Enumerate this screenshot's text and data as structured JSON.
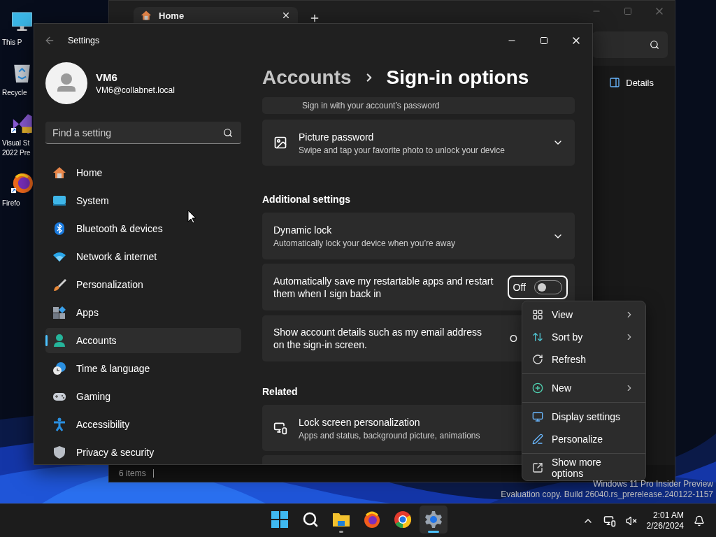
{
  "desktop_icons": [
    {
      "kind": "monitor",
      "lines": [
        "This P"
      ]
    },
    {
      "kind": "recycle",
      "lines": [
        "Recycle"
      ]
    },
    {
      "kind": "vs",
      "lines": [
        "Visual St",
        "2022 Pre"
      ]
    },
    {
      "kind": "firefox",
      "lines": [
        "Firefo"
      ]
    }
  ],
  "explorer": {
    "tab": {
      "label": "Home"
    },
    "details_button": "Details",
    "status": "6 items"
  },
  "settings": {
    "title": "Settings",
    "user": {
      "name": "VM6",
      "email": "VM6@collabnet.local"
    },
    "search": {
      "placeholder": "Find a setting"
    },
    "nav": [
      {
        "label": "Home",
        "selected": false
      },
      {
        "label": "System",
        "selected": false
      },
      {
        "label": "Bluetooth & devices",
        "selected": false
      },
      {
        "label": "Network & internet",
        "selected": false
      },
      {
        "label": "Personalization",
        "selected": false
      },
      {
        "label": "Apps",
        "selected": false
      },
      {
        "label": "Accounts",
        "selected": true
      },
      {
        "label": "Time & language",
        "selected": false
      },
      {
        "label": "Gaming",
        "selected": false
      },
      {
        "label": "Accessibility",
        "selected": false
      },
      {
        "label": "Privacy & security",
        "selected": false
      }
    ],
    "breadcrumb": {
      "parent": "Accounts",
      "current": "Sign-in options"
    },
    "content": [
      {
        "kind": "cut",
        "subtitle": "Sign in with your account’s password"
      },
      {
        "kind": "picture-expander",
        "title": "Picture password",
        "subtitle": "Swipe and tap your favorite photo to unlock your device"
      },
      {
        "kind": "heading",
        "title": "Additional settings"
      },
      {
        "kind": "expander",
        "title": "Dynamic lock",
        "subtitle": "Automatically lock your device when you’re away"
      },
      {
        "kind": "toggle",
        "title": "Automatically save my restartable apps and restart them when I sign back in",
        "state": "Off",
        "on": false,
        "focused": true
      },
      {
        "kind": "covered-toggle",
        "title": "Show account details such as my email address on the sign-in screen.",
        "state": "O"
      },
      {
        "kind": "heading",
        "title": "Related"
      },
      {
        "kind": "lockscreen-link",
        "title": "Lock screen personalization",
        "subtitle": "Apps and status, background picture, animations"
      },
      {
        "kind": "blank"
      }
    ]
  },
  "context_menu": {
    "groups": [
      [
        {
          "label": "View",
          "submenu": true
        },
        {
          "label": "Sort by",
          "submenu": true
        },
        {
          "label": "Refresh",
          "submenu": false
        }
      ],
      [
        {
          "label": "New",
          "submenu": true
        }
      ],
      [
        {
          "label": "Display settings",
          "submenu": false
        },
        {
          "label": "Personalize",
          "submenu": false
        }
      ],
      [
        {
          "label": "Show more options",
          "submenu": false
        }
      ]
    ]
  },
  "watermark": [
    "Windows 11 Pro Insider Preview",
    "Evaluation copy. Build 26040.rs_prerelease.240122-1157"
  ],
  "taskbar": {
    "apps": [
      {
        "running": false,
        "selected": false
      },
      {
        "running": false,
        "selected": false
      },
      {
        "running": true,
        "selected": false
      },
      {
        "running": false,
        "selected": false
      },
      {
        "running": false,
        "selected": false
      },
      {
        "running": true,
        "selected": true
      }
    ],
    "clock": {
      "time": "2:01 AM",
      "date": "2/26/2024"
    }
  }
}
